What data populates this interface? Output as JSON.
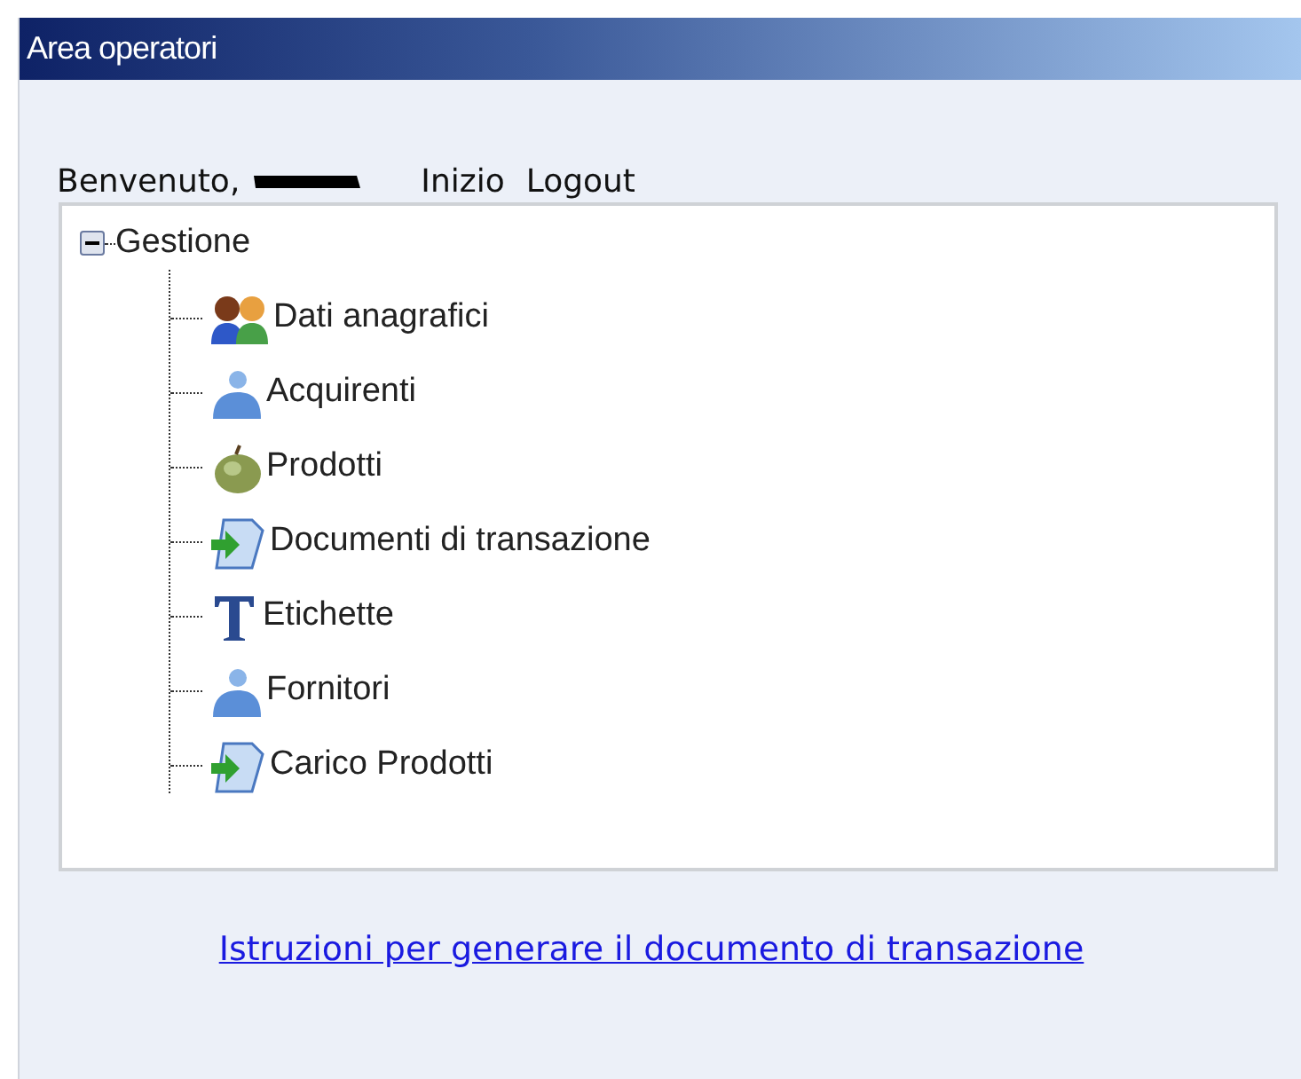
{
  "window": {
    "title": "Area operatori"
  },
  "welcome": {
    "greeting": "Benvenuto,",
    "links": [
      "Inizio",
      "Logout"
    ]
  },
  "tree": [
    {
      "label": "Gestione",
      "expanded": true,
      "children": [
        {
          "label": "Dati anagrafici",
          "kind": "people"
        },
        {
          "label": "Acquirenti",
          "kind": "person"
        },
        {
          "label": "Prodotti",
          "kind": "apple"
        },
        {
          "label": "Documenti di transazione",
          "kind": "document"
        },
        {
          "label": "Etichette",
          "kind": "text"
        },
        {
          "label": "Fornitori",
          "kind": "person"
        },
        {
          "label": "Carico Prodotti",
          "kind": "document"
        }
      ]
    }
  ],
  "footer_link": "Istruzioni per generare il documento di transazione"
}
